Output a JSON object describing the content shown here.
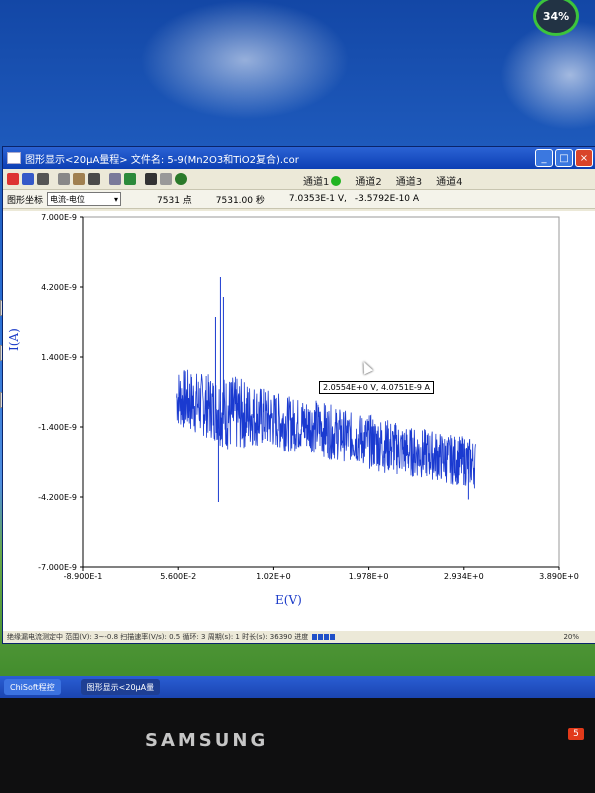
{
  "desktop": {
    "battery_label": "34%"
  },
  "window": {
    "title": "图形显示<20μA量程>   文件名: 5-9(Mn2O3和TiO2复合).cor",
    "controls": {
      "minimize": "_",
      "maximize": "□",
      "close": "×"
    }
  },
  "channels": [
    {
      "label": "通道1"
    },
    {
      "label": "通道2"
    },
    {
      "label": "通道3"
    },
    {
      "label": "通道4"
    }
  ],
  "status_row": {
    "mode_label": "图形坐标",
    "mode_select": "电流-电位",
    "points": "7531 点",
    "time": "7531.00 秒",
    "voltage": "7.0353E-1 V,",
    "current": "-3.5792E-10 A"
  },
  "plot": {
    "tooltip": "2.0554E+0 V,  4.0751E-9 A"
  },
  "chart_data": {
    "type": "line",
    "xlabel": "E(V)",
    "ylabel": "I(A)",
    "ylim": [
      -7e-09,
      7e-09
    ],
    "xlim": [
      -0.89,
      3.89
    ],
    "y_ticks": [
      "7.000E-9",
      "4.200E-9",
      "1.400E-9",
      "-1.400E-9",
      "-4.200E-9",
      "-7.000E-9"
    ],
    "x_ticks": [
      "-8.900E-1",
      "5.600E-2",
      "1.02E+0",
      "1.978E+0",
      "2.934E+0",
      "3.890E+0"
    ],
    "series": [
      {
        "color": "#1a3ad0",
        "envelope": {
          "x": [
            0.05,
            0.2,
            0.4,
            0.6,
            0.8,
            1.0,
            1.2,
            1.4,
            1.6,
            1.8,
            2.0,
            2.2,
            2.4,
            2.6,
            2.8,
            3.0,
            3.05
          ],
          "center": [
            -2e-10,
            -4e-10,
            -6e-10,
            -9e-10,
            -9e-10,
            -1.1e-09,
            -1.3e-09,
            -1.3e-09,
            -1.6e-09,
            -1.8e-09,
            -2e-09,
            -2.2e-09,
            -2.4e-09,
            -2.5e-09,
            -2.7e-09,
            -2.8e-09,
            -2.9e-09
          ],
          "amplitude": [
            1.2e-09,
            1.3e-09,
            1.3e-09,
            1.6e-09,
            1.3e-09,
            1.2e-09,
            1.1e-09,
            1.1e-09,
            1.1e-09,
            1e-09,
            1.1e-09,
            1.1e-09,
            1e-09,
            1e-09,
            1e-09,
            1e-09,
            1e-09
          ]
        },
        "spikes": [
          {
            "x": 0.49,
            "y": 4.6e-09
          },
          {
            "x": 0.52,
            "y": 3.8e-09
          },
          {
            "x": 0.47,
            "y": -4.4e-09
          },
          {
            "x": 0.44,
            "y": 3e-09
          },
          {
            "x": 2.98,
            "y": -4.3e-09
          }
        ]
      }
    ]
  },
  "bottom_status": {
    "text": "绝缘漏电流测定中  范围(V): 3~-0.8  扫描速率(V/s): 0.5  循环: 3  周期(s): 1  时长(s): 36390  进度",
    "page": "20%"
  },
  "taskbar": [
    {
      "label": "ChiSoft程控"
    },
    {
      "label": "图形显示<20μA量"
    }
  ],
  "monitor": {
    "brand": "SAMSUNG",
    "button": "5"
  }
}
